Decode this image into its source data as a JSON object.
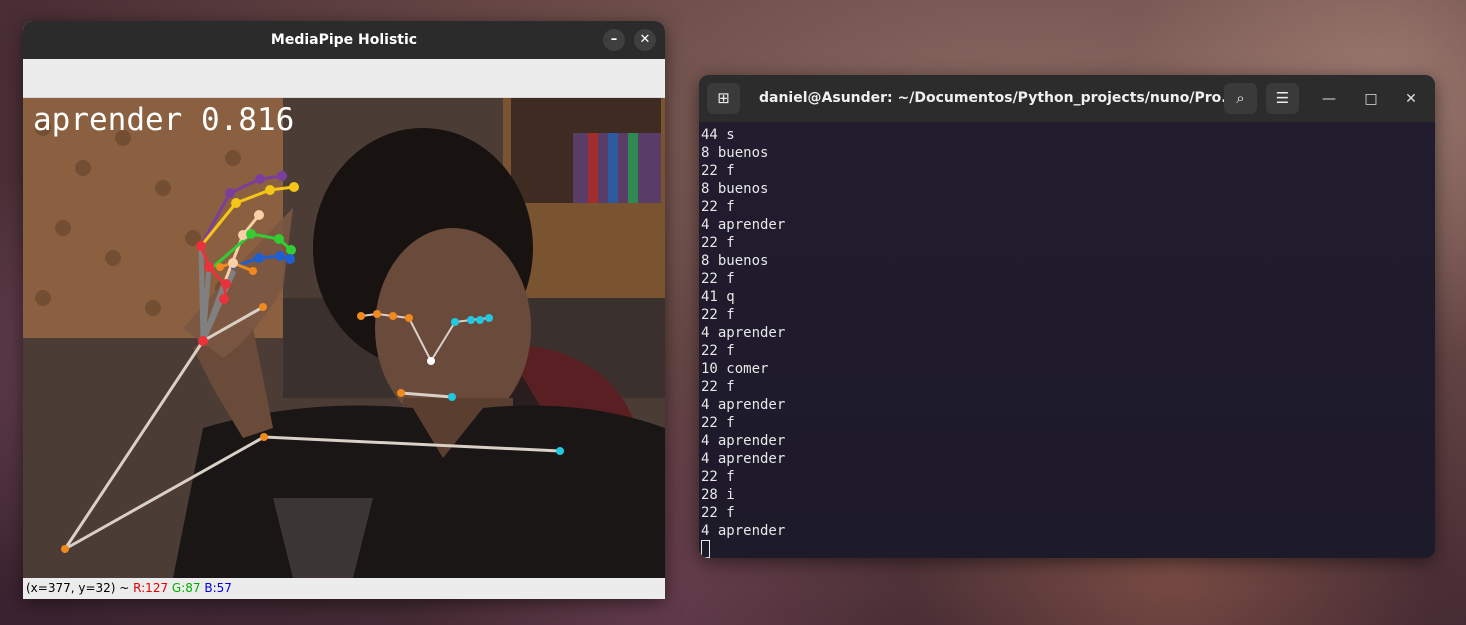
{
  "mediapipe": {
    "title": "MediaPipe Holistic",
    "minimize_glyph": "–",
    "close_glyph": "✕",
    "prediction": "aprender 0.816",
    "status": {
      "coords": "(x=377, y=32) ~ ",
      "r": "R:127",
      "g": "G:87",
      "b": "B:57"
    }
  },
  "terminal": {
    "title": "daniel@Asunder: ~/Documentos/Python_projects/nuno/Pro...",
    "new_tab_glyph": "⊞",
    "search_glyph": "⌕",
    "menu_glyph": "☰",
    "minimize_glyph": "—",
    "maximize_glyph": "□",
    "close_glyph": "✕",
    "lines": [
      "44 s",
      "8 buenos",
      "22 f",
      "8 buenos",
      "22 f",
      "4 aprender",
      "22 f",
      "8 buenos",
      "22 f",
      "41 q",
      "22 f",
      "4 aprender",
      "22 f",
      "10 comer",
      "22 f",
      "4 aprender",
      "22 f",
      "4 aprender",
      "4 aprender",
      "22 f",
      "28 i",
      "22 f",
      "4 aprender"
    ]
  },
  "colors": {
    "terminal_bg": "#1f1b2b",
    "titlebar": "#2b2b2b",
    "landmark_orange": "#f08a1c",
    "landmark_cyan": "#22c8e0",
    "hand_red": "#e8333c",
    "hand_yellow": "#f5c518",
    "hand_green": "#33cc33",
    "hand_blue": "#1f5fd0",
    "hand_purple": "#7a3e9c"
  }
}
